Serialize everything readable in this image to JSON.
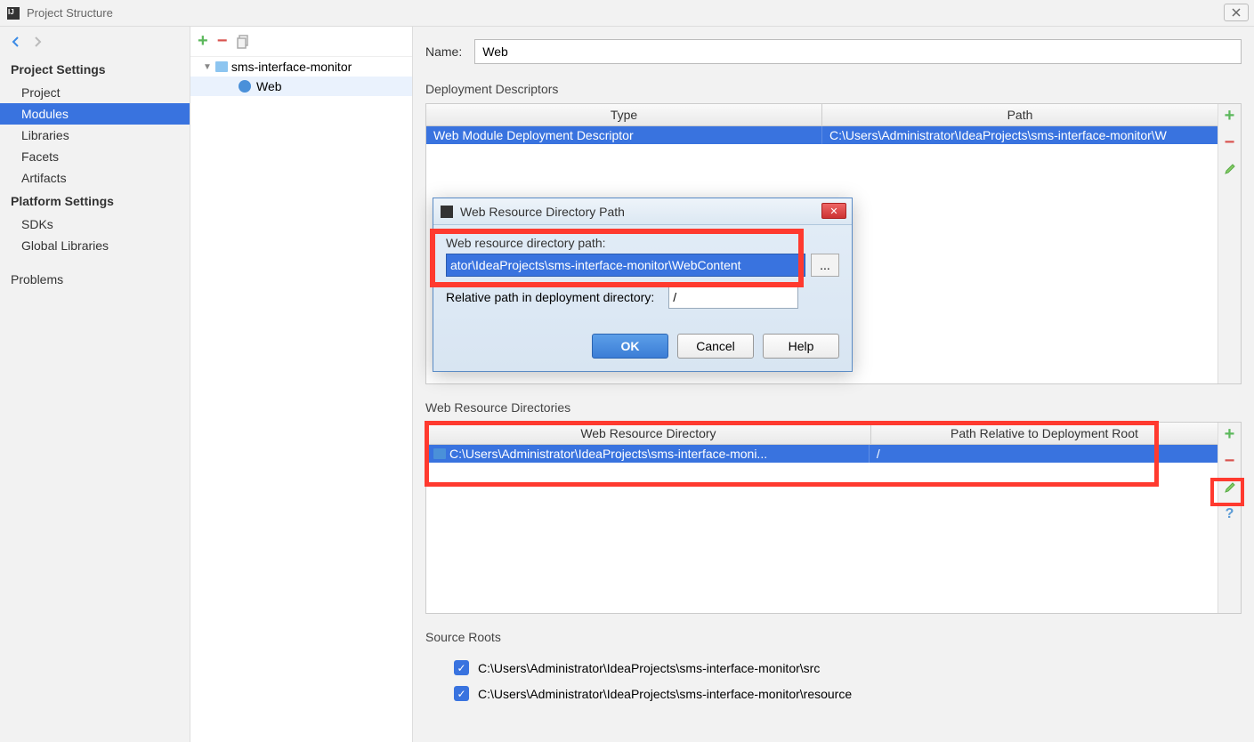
{
  "window": {
    "title": "Project Structure"
  },
  "sidebar": {
    "section1": "Project Settings",
    "items1": [
      "Project",
      "Modules",
      "Libraries",
      "Facets",
      "Artifacts"
    ],
    "section2": "Platform Settings",
    "items2": [
      "SDKs",
      "Global Libraries"
    ],
    "section3": "Problems"
  },
  "tree": {
    "root": "sms-interface-monitor",
    "child": "Web"
  },
  "header": {
    "name_label": "Name:",
    "name_value": "Web"
  },
  "dd": {
    "title": "Deployment Descriptors",
    "col_type": "Type",
    "col_path": "Path",
    "row_type": "Web Module Deployment Descriptor",
    "row_path": "C:\\Users\\Administrator\\IdeaProjects\\sms-interface-monitor\\W"
  },
  "wrd": {
    "title": "Web Resource Directories",
    "col_dir": "Web Resource Directory",
    "col_rel": "Path Relative to Deployment Root",
    "row_dir": "C:\\Users\\Administrator\\IdeaProjects\\sms-interface-moni...",
    "row_rel": "/"
  },
  "source_roots": {
    "title": "Source Roots",
    "items": [
      "C:\\Users\\Administrator\\IdeaProjects\\sms-interface-monitor\\src",
      "C:\\Users\\Administrator\\IdeaProjects\\sms-interface-monitor\\resource"
    ]
  },
  "dialog": {
    "title": "Web Resource Directory Path",
    "label1": "Web resource directory path:",
    "input1": "ator\\IdeaProjects\\sms-interface-monitor\\WebContent",
    "label2": "Relative path in deployment directory:",
    "input2": "/",
    "ok": "OK",
    "cancel": "Cancel",
    "help": "Help",
    "browse": "..."
  }
}
